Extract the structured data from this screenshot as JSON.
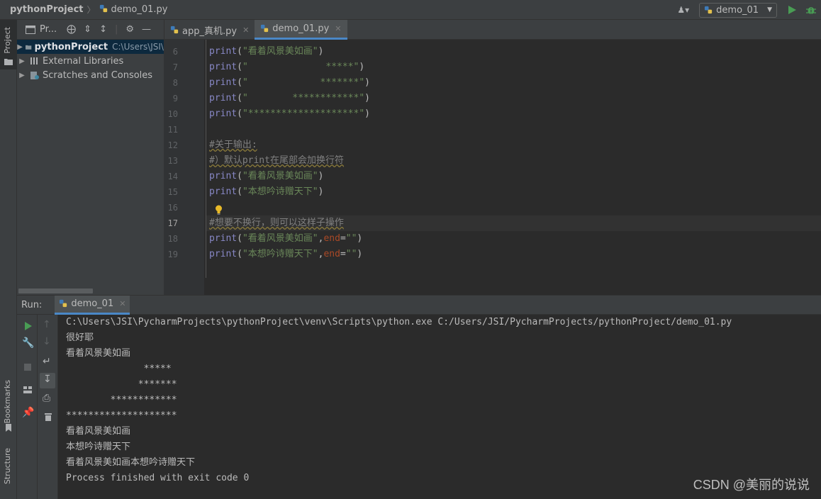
{
  "navbar": {
    "project": "pythonProject",
    "file": "demo_01.py",
    "run_config": "demo_01"
  },
  "left_strip": {
    "project_tab": "Project",
    "bookmarks_tab": "Bookmarks",
    "structure_tab": "Structure"
  },
  "project_panel": {
    "title": "Pr...",
    "tree": [
      {
        "label": "pythonProject",
        "path": "C:\\Users\\JSI\\"
      },
      {
        "label": "External Libraries"
      },
      {
        "label": "Scratches and Consoles"
      }
    ]
  },
  "editor": {
    "tabs": [
      {
        "label": "app_真机.py"
      },
      {
        "label": "demo_01.py"
      }
    ],
    "lines": [
      {
        "n": "6",
        "parts": [
          [
            "kw",
            "print"
          ],
          [
            "pl",
            "("
          ],
          [
            "st",
            "\"看着风景美如画\""
          ],
          [
            "pl",
            ")"
          ]
        ]
      },
      {
        "n": "7",
        "parts": [
          [
            "kw",
            "print"
          ],
          [
            "pl",
            "("
          ],
          [
            "st",
            "\"              *****\""
          ],
          [
            "pl",
            ")"
          ]
        ]
      },
      {
        "n": "8",
        "parts": [
          [
            "kw",
            "print"
          ],
          [
            "pl",
            "("
          ],
          [
            "st",
            "\"             *******\""
          ],
          [
            "pl",
            ")"
          ]
        ]
      },
      {
        "n": "9",
        "parts": [
          [
            "kw",
            "print"
          ],
          [
            "pl",
            "("
          ],
          [
            "st",
            "\"        ************\""
          ],
          [
            "pl",
            ")"
          ]
        ]
      },
      {
        "n": "10",
        "parts": [
          [
            "kw",
            "print"
          ],
          [
            "pl",
            "("
          ],
          [
            "st",
            "\"********************\""
          ],
          [
            "pl",
            ")"
          ]
        ]
      },
      {
        "n": "11",
        "parts": []
      },
      {
        "n": "12",
        "parts": [
          [
            "cm",
            "#关于输出:"
          ]
        ]
      },
      {
        "n": "13",
        "parts": [
          [
            "cm",
            "#）默认print在尾部会加换行符"
          ]
        ]
      },
      {
        "n": "14",
        "parts": [
          [
            "kw",
            "print"
          ],
          [
            "pl",
            "("
          ],
          [
            "st",
            "\"看着风景美如画\""
          ],
          [
            "pl",
            ")"
          ]
        ]
      },
      {
        "n": "15",
        "parts": [
          [
            "kw",
            "print"
          ],
          [
            "pl",
            "("
          ],
          [
            "st",
            "\"本想吟诗赠天下\""
          ],
          [
            "pl",
            ")"
          ]
        ]
      },
      {
        "n": "16",
        "parts": []
      },
      {
        "n": "17",
        "parts": [
          [
            "cm",
            "#想要不换行，则可以这样子操作"
          ]
        ]
      },
      {
        "n": "18",
        "parts": [
          [
            "kw",
            "print"
          ],
          [
            "pl",
            "("
          ],
          [
            "st",
            "\"看着风景美如画\""
          ],
          [
            "pl",
            ","
          ],
          [
            "nm",
            "end"
          ],
          [
            "pl",
            "="
          ],
          [
            "st",
            "\"\""
          ],
          [
            "pl",
            ")"
          ]
        ]
      },
      {
        "n": "19",
        "parts": [
          [
            "kw",
            "print"
          ],
          [
            "pl",
            "("
          ],
          [
            "st",
            "\"本想吟诗赠天下\""
          ],
          [
            "pl",
            ","
          ],
          [
            "nm",
            "end"
          ],
          [
            "pl",
            "="
          ],
          [
            "st",
            "\"\""
          ],
          [
            "pl",
            ")"
          ]
        ]
      }
    ],
    "current_line": "17"
  },
  "run": {
    "label": "Run:",
    "tab": "demo_01",
    "output": [
      "C:\\Users\\JSI\\PycharmProjects\\pythonProject\\venv\\Scripts\\python.exe C:/Users/JSI/PycharmProjects/pythonProject/demo_01.py",
      "很好耶",
      "看着风景美如画",
      "              *****",
      "             *******",
      "        ************",
      "********************",
      "看着风景美如画",
      "本想吟诗赠天下",
      "看着风景美如画本想吟诗赠天下",
      "Process finished with exit code 0"
    ]
  },
  "watermark": "CSDN @美丽的说说",
  "colors": {
    "keyword": "#8888c6",
    "string": "#6a8759",
    "comment": "#808080",
    "param": "#aa4926",
    "accent": "#4a88c7",
    "run_green": "#499c54"
  }
}
